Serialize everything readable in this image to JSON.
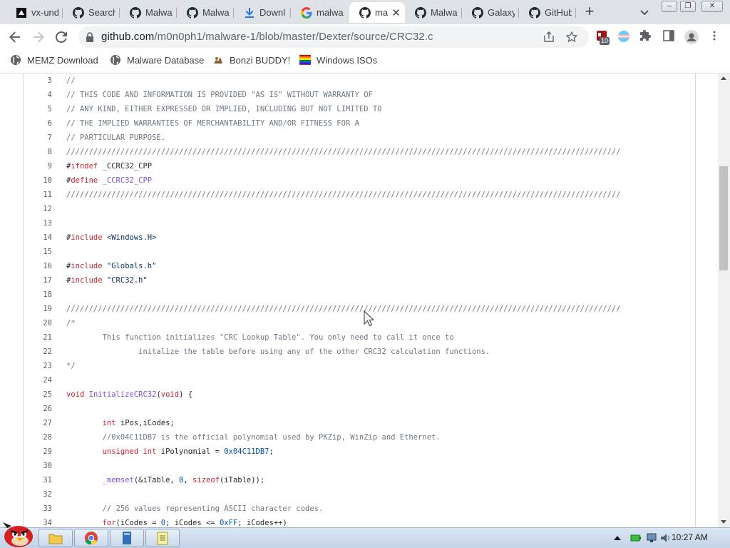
{
  "tabs": [
    {
      "label": "vx-und",
      "icon": "vx-favicon-icon"
    },
    {
      "label": "Search",
      "icon": "github-icon"
    },
    {
      "label": "Malwa",
      "icon": "github-icon"
    },
    {
      "label": "Malwa",
      "icon": "github-icon"
    },
    {
      "label": "Downl",
      "icon": "download-icon"
    },
    {
      "label": "malwa",
      "icon": "google-icon"
    },
    {
      "label": "ma",
      "icon": "github-icon",
      "active": true
    },
    {
      "label": "Malwa",
      "icon": "github-icon"
    },
    {
      "label": "Galaxy",
      "icon": "github-icon"
    },
    {
      "label": "GitHub",
      "icon": "github-icon"
    }
  ],
  "toolbar": {
    "url_host": "github.com",
    "url_path": "/m0n0ph1/malware-1/blob/master/Dexter/source/CRC32.c",
    "extension_badge": "10"
  },
  "bookmarks": [
    {
      "label": "MEMZ Download",
      "icon": "globe-icon"
    },
    {
      "label": "Malware Database",
      "icon": "globe-icon"
    },
    {
      "label": "Bonzi BUDDY!",
      "icon": "bonzi-icon"
    },
    {
      "label": "Windows ISOs",
      "icon": "windows-flag-icon"
    }
  ],
  "code": {
    "lines": [
      {
        "n": "3",
        "segs": [
          {
            "t": "//",
            "c": "comment"
          }
        ]
      },
      {
        "n": "4",
        "segs": [
          {
            "t": "// THIS CODE AND INFORMATION IS PROVIDED \"AS IS\" WITHOUT WARRANTY OF",
            "c": "comment"
          }
        ]
      },
      {
        "n": "5",
        "segs": [
          {
            "t": "// ANY KIND, EITHER EXPRESSED OR IMPLIED, INCLUDING BUT NOT LIMITED TO",
            "c": "comment"
          }
        ]
      },
      {
        "n": "6",
        "segs": [
          {
            "t": "// THE IMPLIED WARRANTIES OF MERCHANTABILITY AND/OR FITNESS FOR A",
            "c": "comment"
          }
        ]
      },
      {
        "n": "7",
        "segs": [
          {
            "t": "// PARTICULAR PURPOSE.",
            "c": "comment"
          }
        ]
      },
      {
        "n": "8",
        "segs": [
          {
            "t": "///////////////////////////////////////////////////////////////////////////////////////////////////////////////////////////",
            "c": "comment"
          }
        ]
      },
      {
        "n": "9",
        "segs": [
          {
            "t": "#",
            "c": ""
          },
          {
            "t": "ifndef",
            "c": "kw"
          },
          {
            "t": " _CCRC32_CPP",
            "c": ""
          }
        ]
      },
      {
        "n": "10",
        "segs": [
          {
            "t": "#",
            "c": ""
          },
          {
            "t": "define",
            "c": "kw"
          },
          {
            "t": " ",
            "c": ""
          },
          {
            "t": "_CCRC32_CPP",
            "c": "fn"
          }
        ]
      },
      {
        "n": "11",
        "segs": [
          {
            "t": "///////////////////////////////////////////////////////////////////////////////////////////////////////////////////////////",
            "c": "comment"
          }
        ]
      },
      {
        "n": "12",
        "segs": []
      },
      {
        "n": "13",
        "segs": []
      },
      {
        "n": "14",
        "segs": [
          {
            "t": "#",
            "c": ""
          },
          {
            "t": "include",
            "c": "kw"
          },
          {
            "t": " <Windows.H>",
            "c": "str"
          }
        ]
      },
      {
        "n": "15",
        "segs": []
      },
      {
        "n": "16",
        "segs": [
          {
            "t": "#",
            "c": ""
          },
          {
            "t": "include",
            "c": "kw"
          },
          {
            "t": " \"Globals.h\"",
            "c": "str"
          }
        ]
      },
      {
        "n": "17",
        "segs": [
          {
            "t": "#",
            "c": ""
          },
          {
            "t": "include",
            "c": "kw"
          },
          {
            "t": " \"CRC32.h\"",
            "c": "str"
          }
        ]
      },
      {
        "n": "18",
        "segs": []
      },
      {
        "n": "19",
        "segs": [
          {
            "t": "///////////////////////////////////////////////////////////////////////////////////////////////////////////////////////////",
            "c": "comment"
          }
        ]
      },
      {
        "n": "20",
        "segs": [
          {
            "t": "/*",
            "c": "comment"
          }
        ]
      },
      {
        "n": "21",
        "segs": [
          {
            "t": "        This function initializes \"CRC Lookup Table\". You only need to call it once to",
            "c": "comment"
          }
        ]
      },
      {
        "n": "22",
        "segs": [
          {
            "t": "                initalize the table before using any of the other CRC32 calculation functions.",
            "c": "comment"
          }
        ]
      },
      {
        "n": "23",
        "segs": [
          {
            "t": "*/",
            "c": "comment"
          }
        ]
      },
      {
        "n": "24",
        "segs": []
      },
      {
        "n": "25",
        "segs": [
          {
            "t": "void",
            "c": "kw"
          },
          {
            "t": " ",
            "c": ""
          },
          {
            "t": "InitializeCRC32",
            "c": "fn"
          },
          {
            "t": "(",
            "c": ""
          },
          {
            "t": "void",
            "c": "kw"
          },
          {
            "t": ") {",
            "c": ""
          }
        ]
      },
      {
        "n": "26",
        "segs": []
      },
      {
        "n": "27",
        "segs": [
          {
            "t": "        ",
            "c": ""
          },
          {
            "t": "int",
            "c": "kw"
          },
          {
            "t": " iPos,iCodes;",
            "c": ""
          }
        ]
      },
      {
        "n": "28",
        "segs": [
          {
            "t": "        //0x04C11DB7 is the official polynomial used by PKZip, WinZip and Ethernet.",
            "c": "comment"
          }
        ]
      },
      {
        "n": "29",
        "segs": [
          {
            "t": "        ",
            "c": ""
          },
          {
            "t": "unsigned",
            "c": "kw"
          },
          {
            "t": " ",
            "c": ""
          },
          {
            "t": "int",
            "c": "kw"
          },
          {
            "t": " iPolynomial = ",
            "c": ""
          },
          {
            "t": "0x04C11DB7",
            "c": "num"
          },
          {
            "t": ";",
            "c": ""
          }
        ]
      },
      {
        "n": "30",
        "segs": []
      },
      {
        "n": "31",
        "segs": [
          {
            "t": "        ",
            "c": ""
          },
          {
            "t": "_memset",
            "c": "fn"
          },
          {
            "t": "(&iTable, ",
            "c": ""
          },
          {
            "t": "0",
            "c": "num"
          },
          {
            "t": ", ",
            "c": ""
          },
          {
            "t": "sizeof",
            "c": "kw"
          },
          {
            "t": "(iTable));",
            "c": ""
          }
        ]
      },
      {
        "n": "32",
        "segs": []
      },
      {
        "n": "33",
        "segs": [
          {
            "t": "        // 256 values representing ASCII character codes.",
            "c": "comment"
          }
        ]
      },
      {
        "n": "34",
        "segs": [
          {
            "t": "        ",
            "c": ""
          },
          {
            "t": "for",
            "c": "kw"
          },
          {
            "t": "(iCodes = ",
            "c": ""
          },
          {
            "t": "0",
            "c": "num"
          },
          {
            "t": "; iCodes <= ",
            "c": ""
          },
          {
            "t": "0xFF",
            "c": "num"
          },
          {
            "t": "; iCodes++)",
            "c": ""
          }
        ]
      }
    ]
  },
  "taskbar": {
    "clock": "10:27 AM",
    "items": [
      "explorer-icon",
      "chrome-icon",
      "app-icon",
      "notepad-icon"
    ]
  }
}
